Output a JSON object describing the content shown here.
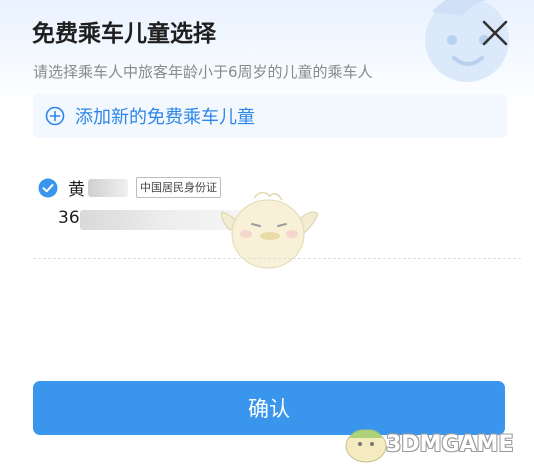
{
  "dialog": {
    "title": "免费乘车儿童选择",
    "subtitle": "请选择乘车人中旅客年龄小于6周岁的儿童的乘车人",
    "close_icon": "close-icon"
  },
  "add_child": {
    "label": "添加新的免费乘车儿童",
    "icon": "plus-circle-icon"
  },
  "passengers": [
    {
      "name_visible": "黄",
      "id_type": "中国居民身份证",
      "id_visible": "36",
      "checked": true
    }
  ],
  "confirm": {
    "label": "确认"
  },
  "watermark": {
    "text": "3DMGAME"
  },
  "colors": {
    "accent": "#3a96ec",
    "link": "#2e86e8",
    "title": "#1f1f1f",
    "subtitle": "#8a8a8a"
  }
}
